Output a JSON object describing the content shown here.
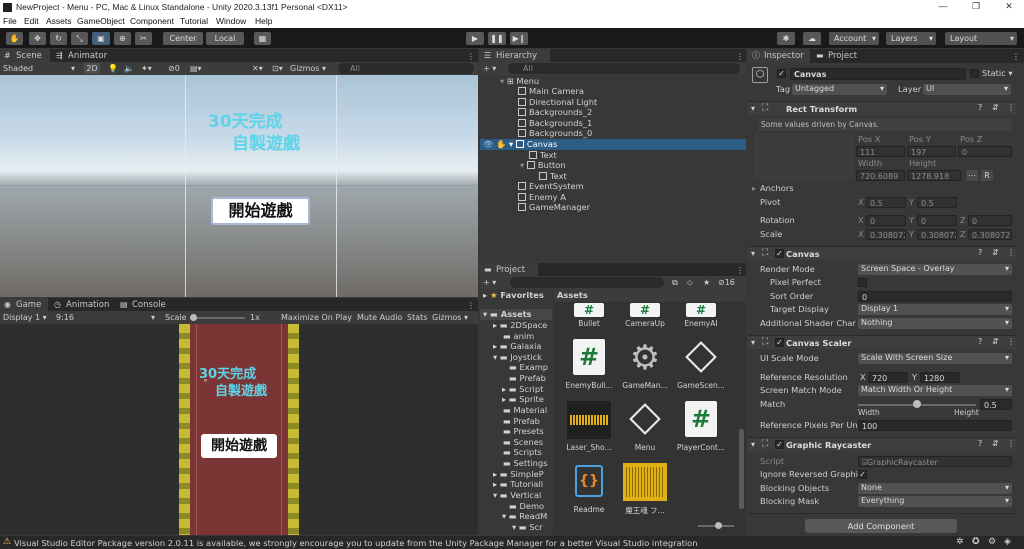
{
  "window": {
    "title": "NewProject - Menu - PC, Mac & Linux Standalone - Unity 2020.3.13f1 Personal <DX11>"
  },
  "menu": [
    "File",
    "Edit",
    "Assets",
    "GameObject",
    "Component",
    "Tutorial",
    "Window",
    "Help"
  ],
  "toolbar": {
    "pivot": "Center",
    "space": "Local",
    "account": "Account",
    "layers": "Layers",
    "layout": "Layout"
  },
  "scene": {
    "tabs": [
      "Scene",
      "Animator"
    ],
    "shading": "Shaded",
    "mode2d": "2D",
    "hidden_count": "0",
    "gizmos": "Gizmos",
    "search": "All",
    "title_line1": "30天完成",
    "title_line2": "自製遊戲",
    "start_button": "開始遊戲"
  },
  "game": {
    "tabs": [
      "Game",
      "Animation",
      "Console"
    ],
    "display": "Display 1",
    "aspect": "9:16",
    "scale_label": "Scale",
    "scale_value": "1x",
    "maximize": "Maximize On Play",
    "mute": "Mute Audio",
    "stats": "Stats",
    "gizmos": "Gizmos",
    "title_line1": "30天完成",
    "title_line2": "自製遊戲",
    "start_button": "開始遊戲"
  },
  "hierarchy": {
    "tab": "Hierarchy",
    "search": "All",
    "items": [
      "Menu",
      "Main Camera",
      "Directional Light",
      "Backgrounds_2",
      "Backgrounds_1",
      "Backgrounds_0",
      "Canvas",
      "Text",
      "Button",
      "Text",
      "EventSystem",
      "Enemy A",
      "GameManager"
    ]
  },
  "project": {
    "tab": "Project",
    "hidden_count": "16",
    "favorites": "Favorites",
    "assets_header": "Assets",
    "tree": [
      "Assets",
      "2DSpace",
      "anim",
      "Galaxia",
      "Joystick",
      "Examp",
      "Prefab",
      "Script",
      "Sprite",
      "Material",
      "Prefab",
      "Presets",
      "Scenes",
      "Scripts",
      "Settings",
      "SimpleP",
      "Tutoriall",
      "Vertical",
      "Demo",
      "ReadM",
      "Scr"
    ],
    "assets": [
      "Bullet",
      "CameraUp",
      "EnemyAI",
      "EnemyBull...",
      "GameMan...",
      "GameScen...",
      "Laser_Sho...",
      "Menu",
      "PlayerCont...",
      "Readme",
      "魔王魂 フ..."
    ]
  },
  "inspector": {
    "tabs": [
      "Inspector",
      "Project"
    ],
    "object_name": "Canvas",
    "static": "Static",
    "tag_label": "Tag",
    "tag": "Untagged",
    "layer_label": "Layer",
    "layer": "UI",
    "rect_transform": {
      "title": "Rect Transform",
      "note": "Some values driven by Canvas.",
      "posx_label": "Pos X",
      "posy_label": "Pos Y",
      "posz_label": "Pos Z",
      "posx": "111",
      "posy": "197",
      "posz": "0",
      "width_label": "Width",
      "height_label": "Height",
      "width": "720.6089",
      "height": "1278.918",
      "r_button": "R",
      "anchors": "Anchors",
      "pivot": "Pivot",
      "pivot_x": "0.5",
      "pivot_y": "0.5",
      "rotation": "Rotation",
      "rot_x": "0",
      "rot_y": "0",
      "rot_z": "0",
      "scale": "Scale",
      "scale_x": "0.308072",
      "scale_y": "0.308072",
      "scale_z": "0.308072",
      "x": "X",
      "y": "Y",
      "z": "Z"
    },
    "canvas": {
      "title": "Canvas",
      "render_mode_label": "Render Mode",
      "render_mode": "Screen Space - Overlay",
      "pixel_perfect": "Pixel Perfect",
      "sort_order_label": "Sort Order",
      "sort_order": "0",
      "target_display_label": "Target Display",
      "target_display": "Display 1",
      "shader_label": "Additional Shader Channe",
      "shader": "Nothing"
    },
    "canvas_scaler": {
      "title": "Canvas Scaler",
      "scale_mode_label": "UI Scale Mode",
      "scale_mode": "Scale With Screen Size",
      "ref_res_label": "Reference Resolution",
      "ref_x": "720",
      "ref_y": "1280",
      "match_mode_label": "Screen Match Mode",
      "match_mode": "Match Width Or Height",
      "match_label": "Match",
      "match_value": "0.5",
      "match_fraction": 0.5,
      "width": "Width",
      "height": "Height",
      "ref_ppu_label": "Reference Pixels Per Unit",
      "ref_ppu": "100"
    },
    "raycaster": {
      "title": "Graphic Raycaster",
      "script_label": "Script",
      "script": "GraphicRaycaster",
      "ignore_label": "Ignore Reversed Graphics",
      "blocking_objects_label": "Blocking Objects",
      "blocking_objects": "None",
      "blocking_mask_label": "Blocking Mask",
      "blocking_mask": "Everything"
    },
    "add_component": "Add Component"
  },
  "status": {
    "message": "Visual Studio Editor Package version 2.0.11 is available, we strongly encourage you to update from the Unity Package Manager for a better Visual Studio integration"
  },
  "colors": {
    "accent": "#2c5d87",
    "title_cyan": "#5fd3e8",
    "warning": "#f2c94c"
  }
}
